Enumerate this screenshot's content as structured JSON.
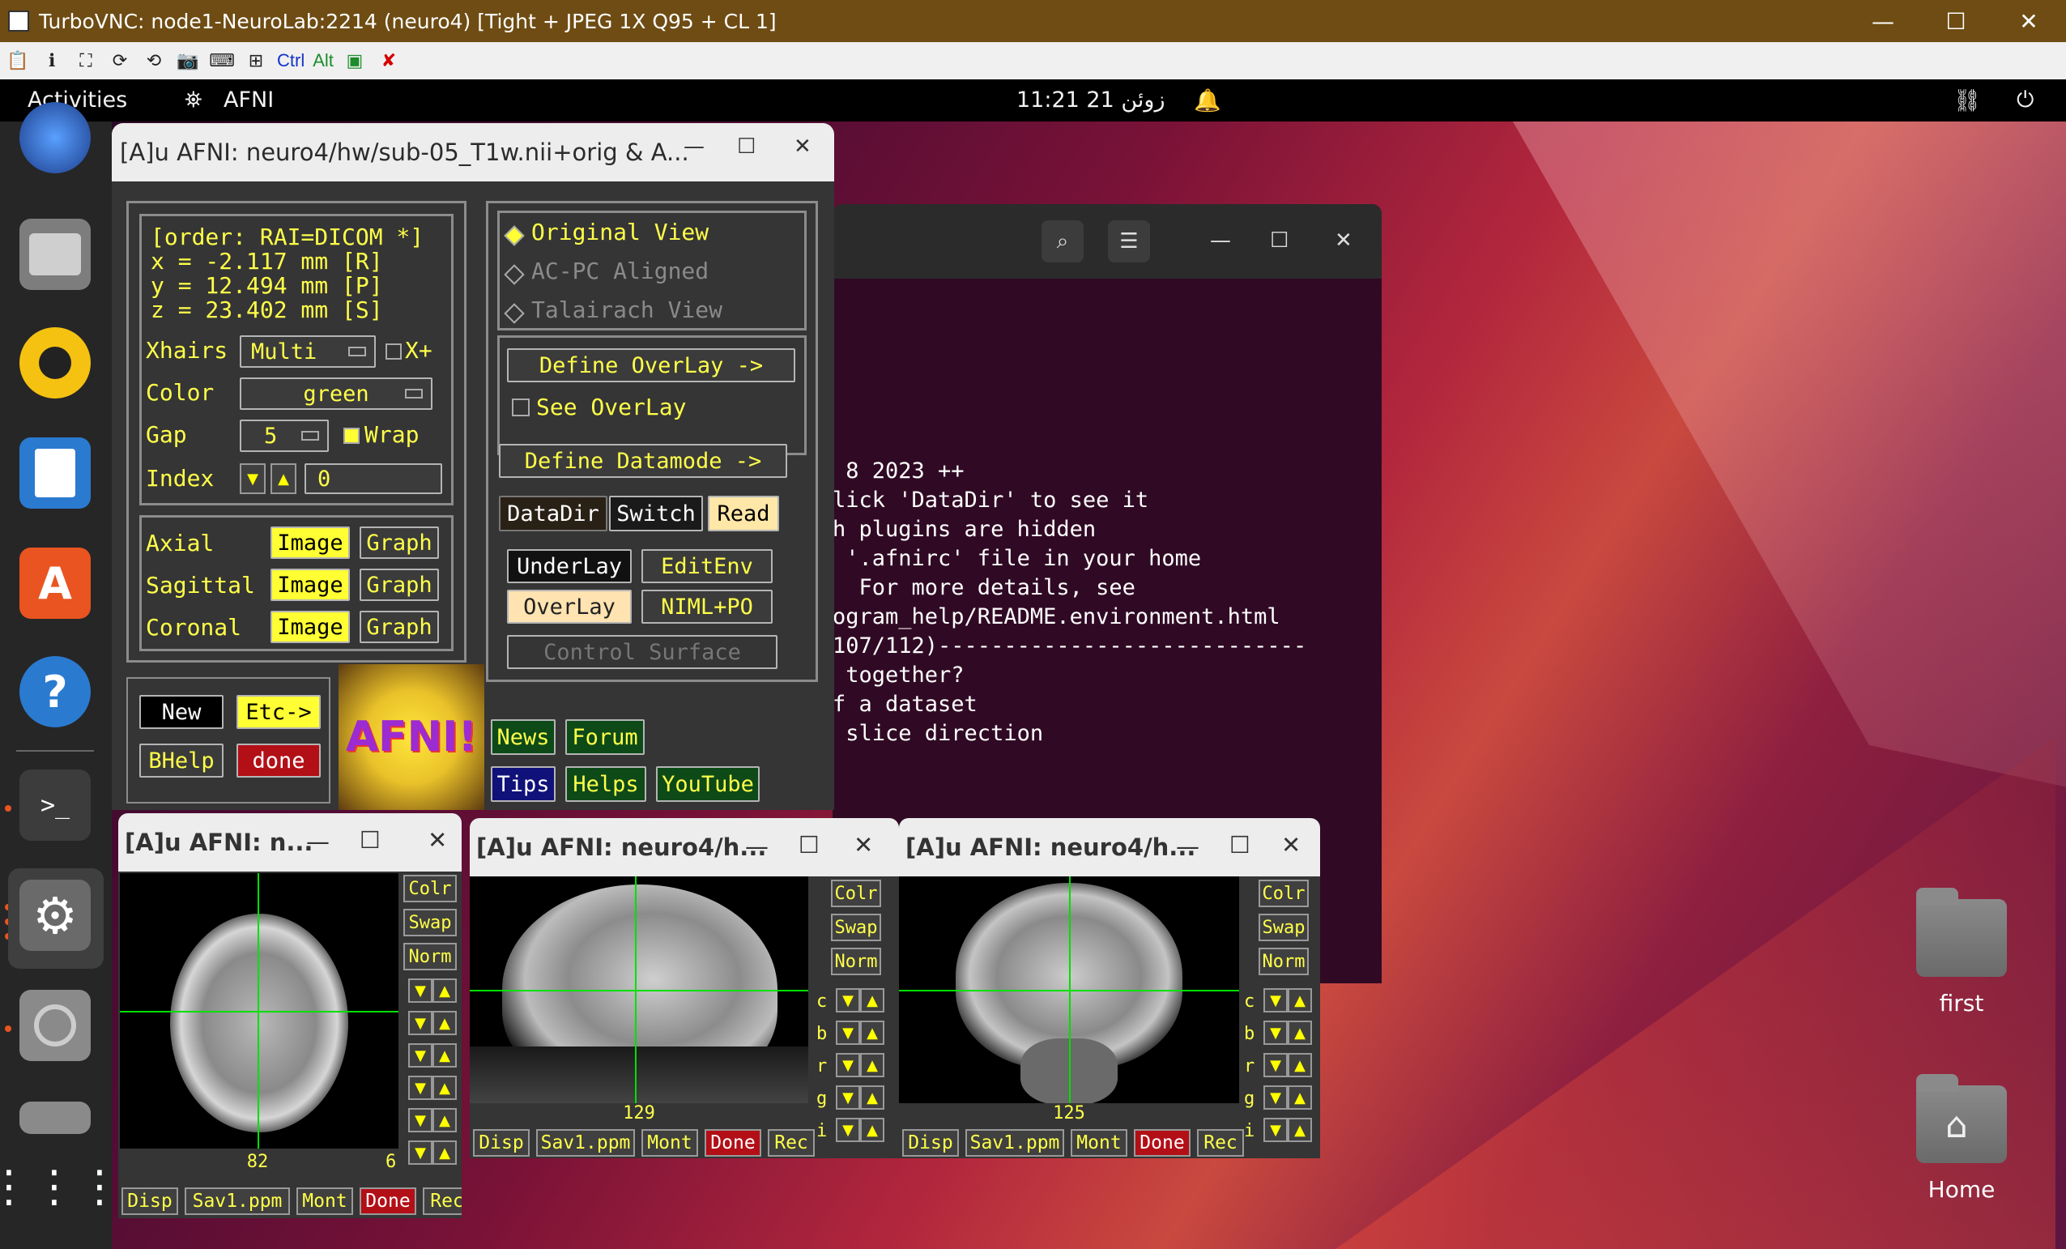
{
  "vnc": {
    "title": "TurboVNC: node1-NeuroLab:2214 (neuro4) [Tight + JPEG 1X Q95 + CL 1]",
    "ctrl": "Ctrl",
    "alt": "Alt"
  },
  "topbar": {
    "activities": "Activities",
    "app": "AFNI",
    "clock": "11:21  21 زوئن"
  },
  "terminal": {
    "lines": [
      " 8 2023 ++",
      "lick 'DataDir' to see it",
      "h plugins are hidden",
      " '.afnirc' file in your home",
      "  For more details, see",
      "ogram_help/README.environment.html",
      "",
      "",
      "107/112)----------------------------",
      " together?",
      "f a dataset",
      " slice direction"
    ]
  },
  "afni": {
    "title": "[A]u AFNI: neuro4/hw/sub-05_T1w.nii+orig & A...",
    "coords": {
      "order": "[order: RAI=DICOM *]",
      "x": "x =   -2.117 mm [R]",
      "y": "y =   12.494 mm [P]",
      "z": "z =   23.402 mm [S]"
    },
    "xhairs_label": "Xhairs",
    "xhairs_value": "Multi",
    "xplus": "X+",
    "color_label": "Color",
    "color_value": "green",
    "gap_label": "Gap",
    "gap_value": "5",
    "wrap": "Wrap",
    "index_label": "Index",
    "index_value": "0",
    "views": [
      {
        "name": "Axial",
        "image": "Image",
        "graph": "Graph"
      },
      {
        "name": "Sagittal",
        "image": "Image",
        "graph": "Graph"
      },
      {
        "name": "Coronal",
        "image": "Image",
        "graph": "Graph"
      }
    ],
    "new": "New",
    "etc": "Etc->",
    "bhelp": "BHelp",
    "done": "done",
    "logo": "AFNI!",
    "view_modes": [
      "Original View",
      "AC-PC Aligned",
      "Talairach View"
    ],
    "define_overlay": "Define OverLay ->",
    "see_overlay": "See OverLay",
    "define_datamode": "Define Datamode ->",
    "datadir": "DataDir",
    "switch": "Switch",
    "read": "Read",
    "underlay": "UnderLay",
    "editenv": "EditEnv",
    "overlay": "OverLay",
    "niml": "NIML+PO",
    "control_surface": "Control Surface",
    "news": "News",
    "forum": "Forum",
    "tips": "Tips",
    "helps": "Helps",
    "youtube": "YouTube"
  },
  "viewers": [
    {
      "title": "[A]u AFNI: n...",
      "slice": "82",
      "extra": "6",
      "side": [
        "Colr",
        "Swap",
        "Norm"
      ],
      "bottom": [
        "Disp",
        "Sav1.ppm",
        "Mont",
        "Done",
        "Rec"
      ]
    },
    {
      "title": "[A]u AFNI: neuro4/h...",
      "slice": "129",
      "side": [
        "Colr",
        "Swap",
        "Norm"
      ],
      "letters": [
        "c",
        "b",
        "r",
        "g",
        "i"
      ],
      "bottom": [
        "Disp",
        "Sav1.ppm",
        "Mont",
        "Done",
        "Rec"
      ]
    },
    {
      "title": "[A]u AFNI: neuro4/h...",
      "slice": "125",
      "side": [
        "Colr",
        "Swap",
        "Norm"
      ],
      "letters": [
        "c",
        "b",
        "r",
        "g",
        "i"
      ],
      "bottom": [
        "Disp",
        "Sav1.ppm",
        "Mont",
        "Done",
        "Rec"
      ]
    }
  ],
  "desktop": {
    "first": "first",
    "home": "Home"
  },
  "colors": {
    "accent": "#e95420",
    "afni_yellow": "#ffff33",
    "done_red": "#b30f17"
  }
}
